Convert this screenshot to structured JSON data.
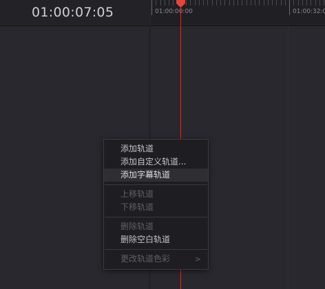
{
  "header": {
    "timecode": "01:00:07:05"
  },
  "ruler": {
    "labels": [
      "01:00:00:00",
      "01:00:32:00"
    ]
  },
  "colors": {
    "playhead": "#c8362e",
    "menu_background": "#1e1e22",
    "menu_highlight": "#2e2e33"
  },
  "context_menu": {
    "add_track": "添加轨道",
    "add_custom_track": "添加自定义轨道...",
    "add_subtitle_track": "添加字幕轨道",
    "move_track_up": "上移轨道",
    "move_track_down": "下移轨道",
    "delete_track": "删除轨道",
    "delete_empty_tracks": "删除空白轨道",
    "change_track_color": "更改轨道色彩",
    "submenu_arrow": ">"
  },
  "icons": {
    "playhead": "playhead-marker-icon"
  }
}
